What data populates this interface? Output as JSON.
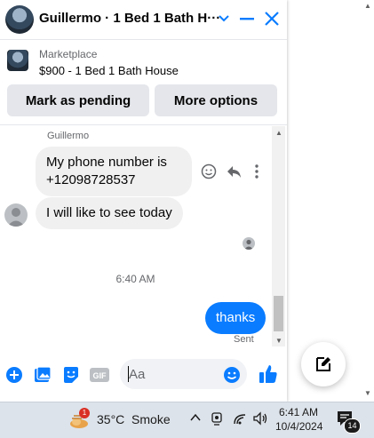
{
  "header": {
    "title": "Guillermo · 1 Bed 1 Bath H···",
    "avatar_icon": "house-photo-icon",
    "controls": [
      "chevron-down-icon",
      "minimize-icon",
      "close-icon"
    ]
  },
  "marketplace": {
    "label": "Marketplace",
    "item": "$900 - 1 Bed 1 Bath House"
  },
  "actions": {
    "mark_pending": "Mark as pending",
    "more_options": "More options"
  },
  "conversation": {
    "sender_name": "Guillermo",
    "messages": [
      {
        "direction": "incoming",
        "lines": [
          "My phone number is",
          "+12098728537"
        ]
      },
      {
        "direction": "incoming",
        "lines": [
          "I will like to see today"
        ]
      },
      {
        "direction": "outgoing",
        "lines": [
          "thanks"
        ]
      }
    ],
    "time_separator": "6:40 AM",
    "sent_status": "Sent"
  },
  "composer": {
    "placeholder": "Aa",
    "icons": [
      "add-circle-icon",
      "photo-icon",
      "sticker-icon",
      "gif-icon",
      "emoji-icon",
      "thumbs-up-icon"
    ]
  },
  "taskbar": {
    "weather_badge": "1",
    "weather_text": "35°C  Smoke",
    "time": "6:41 AM",
    "date": "10/4/2024",
    "notification_count": "14"
  },
  "colors": {
    "accent": "#0a7cff",
    "bubble_in": "#f0f0f0",
    "button_bg": "#e4e6eb",
    "taskbar_bg": "#dde3ea"
  }
}
